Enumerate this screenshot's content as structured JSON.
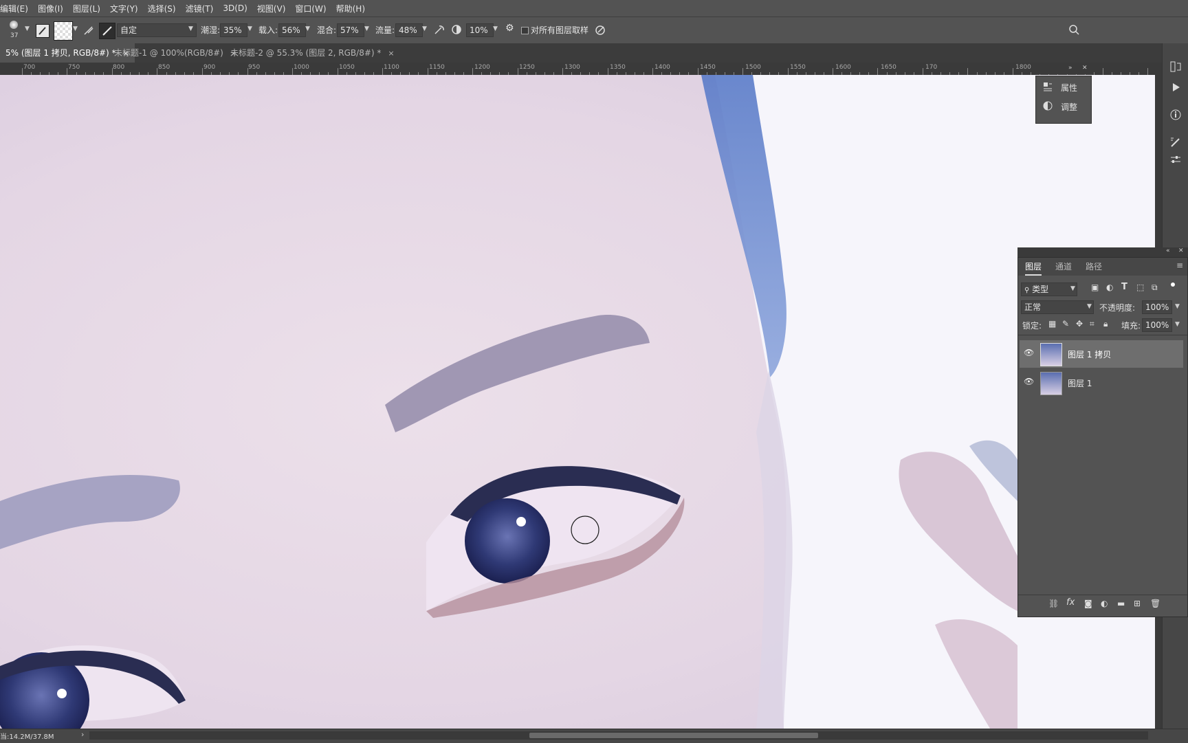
{
  "menu": [
    "编辑(E)",
    "图像(I)",
    "图层(L)",
    "文字(Y)",
    "选择(S)",
    "滤镜(T)",
    "3D(D)",
    "视图(V)",
    "窗口(W)",
    "帮助(H)"
  ],
  "options": {
    "brush_size": "37",
    "mode_label": "自定",
    "wet_label": "潮湿:",
    "wet_value": "35%",
    "load_label": "载入:",
    "load_value": "56%",
    "mix_label": "混合:",
    "mix_value": "57%",
    "flow_label": "流量:",
    "flow_value": "48%",
    "angle_value": "10%",
    "sample_all_label": "对所有图层取样"
  },
  "tabs": [
    {
      "label": "5% (图层 1 拷贝, RGB/8#) *",
      "close": "×"
    },
    {
      "label": "未标题-1 @ 100%(RGB/8#)",
      "close": "×"
    },
    {
      "label": "未标题-2 @ 55.3% (图层 2, RGB/8#) *",
      "close": "×"
    }
  ],
  "ruler": [
    "700",
    "750",
    "800",
    "850",
    "900",
    "950",
    "1000",
    "1050",
    "1100",
    "1150",
    "1200",
    "1250",
    "1300",
    "1350",
    "1400",
    "1450",
    "1500",
    "1550",
    "1600",
    "1650",
    "170",
    "1800"
  ],
  "properties": {
    "items": [
      "属性",
      "调整"
    ]
  },
  "layers_panel": {
    "tabs": [
      "图层",
      "通道",
      "路径"
    ],
    "filter_label": "类型",
    "blend_mode": "正常",
    "opacity_label": "不透明度:",
    "opacity_value": "100%",
    "lock_label": "锁定:",
    "fill_label": "填充:",
    "fill_value": "100%",
    "layers": [
      {
        "name": "图层 1 拷贝",
        "selected": true
      },
      {
        "name": "图层 1",
        "selected": false
      }
    ]
  },
  "status": {
    "doc_size": "当:14.2M/37.8M",
    "arrow": "›"
  }
}
